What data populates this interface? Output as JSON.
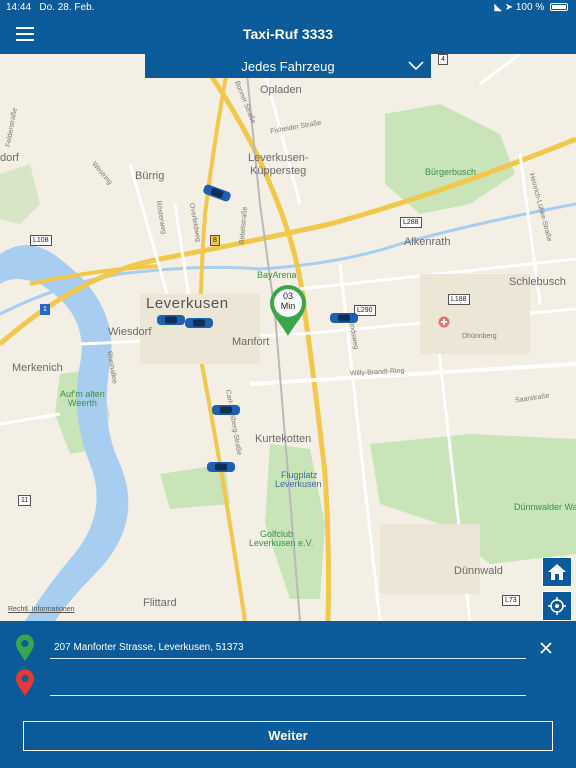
{
  "status_bar": {
    "time": "14:44",
    "date": "Do. 28. Feb.",
    "battery": "100 %"
  },
  "nav": {
    "title": "Taxi-Ruf 3333"
  },
  "filter": {
    "label": "Jedes Fahrzeug"
  },
  "map": {
    "places": {
      "opladen": "Opladen",
      "kuppersteg1": "Leverkusen-",
      "kuppersteg2": "Küppersteg",
      "burrig": "Bürrig",
      "leverkusen": "Leverkusen",
      "wiesdorf": "Wiesdorf",
      "manfort": "Manfort",
      "alkenrath": "Alkenrath",
      "schlebusch": "Schlebusch",
      "merkenich": "Merkenich",
      "kurtekotten": "Kurtekotten",
      "flittard": "Flittard",
      "dunnwald": "Dünnwald",
      "dorf": "dorf"
    },
    "pois": {
      "burgerbusch": "Bürgerbusch",
      "bayarena": "BayArena",
      "aufmalten1": "Auf'm alten",
      "aufmalten2": "Weerth",
      "flugplatz1": "Flugplatz",
      "flugplatz2": "Leverkusen",
      "golfclub1": "Golfclub",
      "golfclub2": "Leverkusen e.V.",
      "dunnwalder": "Dünnwalder Wa"
    },
    "streets": {
      "fixheider": "Fixheider Straße",
      "willy": "Willy-Brandt-Ring",
      "monsweg": "Mondsweg",
      "dhunnberg": "Dhünnberg",
      "saarstrasse": "Saarstraße",
      "westring": "Westring",
      "bonner": "Bonner Straße",
      "rheinallee": "Rheinallee",
      "felder": "Felderstraße",
      "heinrich": "Heinrich-Lübke-Straße",
      "beberstrasse": "Bebelstraße",
      "rosterweg": "Rösterweg",
      "overfeldweg": "Overfeldweg",
      "carl": "Carl-Duisberg-Straße"
    },
    "shields": {
      "b4": "4",
      "l108": "L108",
      "l288": "L288",
      "l290": "L290",
      "l188": "L188",
      "a1": "1",
      "b8": "8",
      "b11": "11",
      "l73": "L73"
    },
    "eta_marker": {
      "line1": "03",
      "line2": "Min"
    },
    "legal": "Rechtl. Informationen"
  },
  "addresses": {
    "pickup_value": "207 Manforter Strasse, Leverkusen, 51373",
    "destination_value": ""
  },
  "buttons": {
    "continue": "Weiter"
  },
  "colors": {
    "primary": "#0b5a99",
    "pickup_pin": "#3aa64a",
    "destination_pin": "#e53935",
    "taxi": "#1e5fb0"
  },
  "icons": [
    "menu-icon",
    "chevron-down-icon",
    "home-icon",
    "locate-icon",
    "clear-icon",
    "pickup-pin-icon",
    "destination-pin-icon",
    "taxi-icon"
  ]
}
